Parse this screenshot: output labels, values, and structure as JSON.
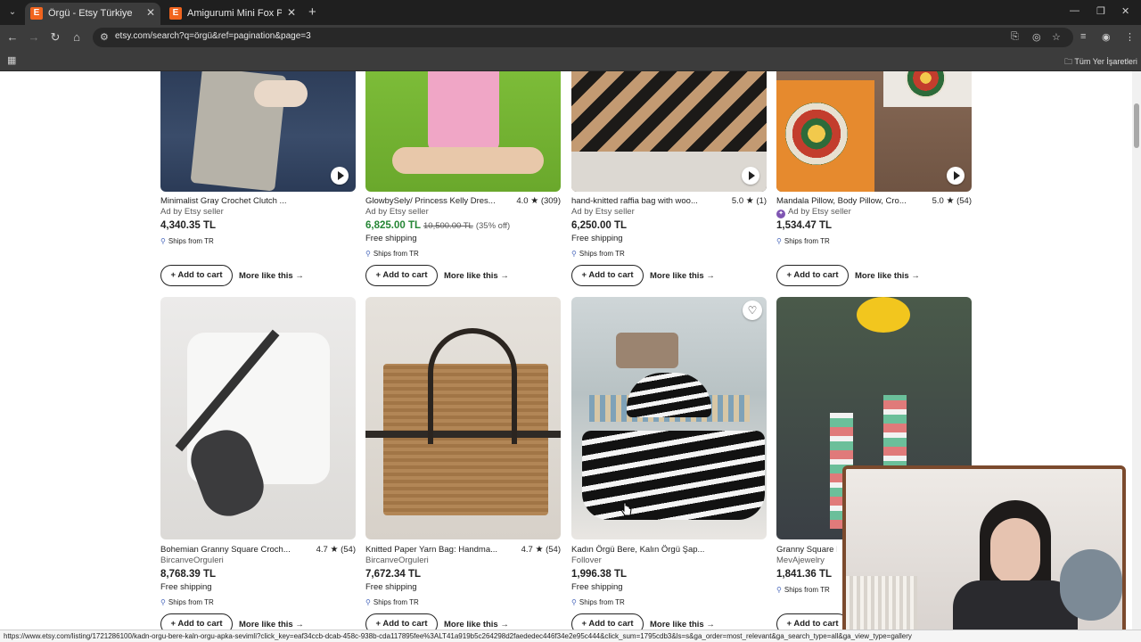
{
  "browser": {
    "tabs": [
      {
        "title": "Örgü - Etsy Türkiye",
        "favicon": "E",
        "active": true
      },
      {
        "title": "Amigurumi Mini Fox Pattern: C",
        "favicon": "E",
        "active": false
      }
    ],
    "url": "etsy.com/search?q=örgü&ref=pagination&page=3",
    "bookmarks_folder": "Tüm Yer İşaretleri"
  },
  "listings_row1": [
    {
      "title": "Minimalist Gray Crochet Clutch ...",
      "rating": "",
      "reviews": "",
      "seller": "Ad by Etsy seller",
      "star_seller": false,
      "price": "4,340.35 TL",
      "original_price": "",
      "discount": "",
      "free_shipping": "",
      "ships_from": "Ships from TR",
      "video": true
    },
    {
      "title": "GlowbySely/ Princess Kelly Dres...",
      "rating": "4.0",
      "reviews": "(309)",
      "seller": "Ad by Etsy seller",
      "star_seller": false,
      "price": "6,825.00 TL",
      "original_price": "10,500.00 TL",
      "discount": "(35% off)",
      "free_shipping": "Free shipping",
      "ships_from": "Ships from TR",
      "video": false
    },
    {
      "title": "hand-knitted raffia bag with woo...",
      "rating": "5.0",
      "reviews": "(1)",
      "seller": "Ad by Etsy seller",
      "star_seller": false,
      "price": "6,250.00 TL",
      "original_price": "",
      "discount": "",
      "free_shipping": "Free shipping",
      "ships_from": "Ships from TR",
      "video": true
    },
    {
      "title": "Mandala Pillow, Body Pillow, Cro...",
      "rating": "5.0",
      "reviews": "(54)",
      "seller": "Ad by Etsy seller",
      "star_seller": true,
      "price": "1,534.47 TL",
      "original_price": "",
      "discount": "",
      "free_shipping": "",
      "ships_from": "Ships from TR",
      "video": true
    }
  ],
  "listings_row2": [
    {
      "title": "Bohemian Granny Square Croch...",
      "rating": "4.7",
      "reviews": "(54)",
      "seller": "BircanveOrguleri",
      "price": "8,768.39 TL",
      "free_shipping": "Free shipping",
      "ships_from": "Ships from TR"
    },
    {
      "title": "Knitted Paper Yarn Bag: Handma...",
      "rating": "4.7",
      "reviews": "(54)",
      "seller": "BircanveOrguleri",
      "price": "7,672.34 TL",
      "free_shipping": "Free shipping",
      "ships_from": "Ships from TR"
    },
    {
      "title": "Kadın Örgü Bere, Kalın Örgü Şap...",
      "rating": "",
      "reviews": "",
      "seller": "Follover",
      "price": "1,996.38 TL",
      "free_shipping": "Free shipping",
      "ships_from": "Ships from TR"
    },
    {
      "title": "Granny Square E",
      "rating": "",
      "reviews": "",
      "seller": "MevAjewelry",
      "price": "1,841.36 TL",
      "free_shipping": "",
      "ships_from": "Ships from TR"
    }
  ],
  "actions": {
    "add_to_cart": "Add to cart",
    "more_like_this": "More like this"
  },
  "status_url": "https://www.etsy.com/listing/1721286100/kadn-orgu-bere-kaln-orgu-apka-sevimli?click_key=eaf34ccb-dcab-458c-938b-cda117895fee%3ALT41a919b5c264298d2faededec446f34e2e95c444&click_sum=1795cdb3&ls=s&ga_order=most_relevant&ga_search_type=all&ga_view_type=gallery"
}
